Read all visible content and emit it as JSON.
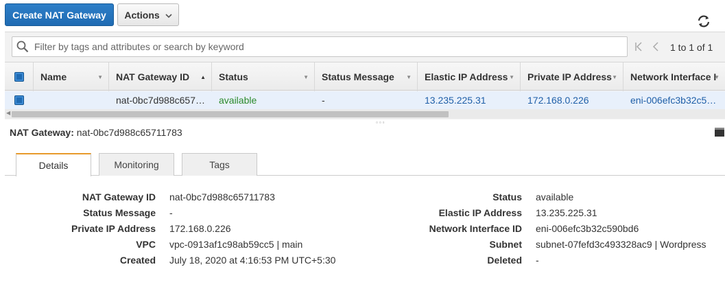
{
  "toolbar": {
    "create_label": "Create NAT Gateway",
    "actions_label": "Actions"
  },
  "filter": {
    "placeholder": "Filter by tags and attributes or search by keyword"
  },
  "pager": {
    "range": "1 to 1 of 1"
  },
  "table": {
    "columns": [
      "Name",
      "NAT Gateway ID",
      "Status",
      "Status Message",
      "Elastic IP Address",
      "Private IP Address",
      "Network Interface I"
    ],
    "row": {
      "name": "",
      "nat_gateway_id": "nat-0bc7d988c657…",
      "status": "available",
      "status_message": "-",
      "elastic_ip": "13.235.225.31",
      "private_ip": "172.168.0.226",
      "network_interface": "eni-006efc3b32c5…"
    }
  },
  "details": {
    "header_label": "NAT Gateway:",
    "header_value": "nat-0bc7d988c65711783",
    "tabs": [
      "Details",
      "Monitoring",
      "Tags"
    ],
    "left": [
      {
        "label": "NAT Gateway ID",
        "value": "nat-0bc7d988c65711783"
      },
      {
        "label": "Status Message",
        "value": "-"
      },
      {
        "label": "Private IP Address",
        "value": "172.168.0.226"
      },
      {
        "label": "VPC",
        "value": "vpc-0913af1c98ab59cc5 | main"
      },
      {
        "label": "Created",
        "value": "July 18, 2020 at 4:16:53 PM UTC+5:30"
      }
    ],
    "right": [
      {
        "label": "Status",
        "value": "available"
      },
      {
        "label": "Elastic IP Address",
        "value": "13.235.225.31"
      },
      {
        "label": "Network Interface ID",
        "value": "eni-006efc3b32c590bd6"
      },
      {
        "label": "Subnet",
        "value": "subnet-07fefd3c493328ac9 | Wordpress"
      },
      {
        "label": "Deleted",
        "value": "-"
      }
    ]
  },
  "colors": {
    "primary": "#1f6bb3",
    "status_green": "#2b8a2b",
    "link_blue": "#1f5fa8",
    "active_tab_accent": "#e79a2b"
  }
}
